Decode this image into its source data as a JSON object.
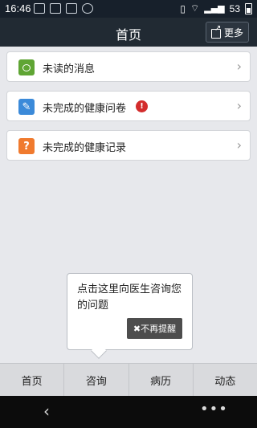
{
  "status_bar": {
    "time": "16:46",
    "battery": "53"
  },
  "header": {
    "title": "首页",
    "more_label": "更多"
  },
  "list": [
    {
      "label": "未读的消息"
    },
    {
      "label": "未完成的健康问卷",
      "badge": "!"
    },
    {
      "label": "未完成的健康记录"
    }
  ],
  "tooltip": {
    "text": "点击这里向医生咨询您的问题",
    "dismiss_label": "✖不再提醒"
  },
  "tabs": [
    {
      "label": "首页"
    },
    {
      "label": "咨询"
    },
    {
      "label": "病历"
    },
    {
      "label": "动态"
    }
  ],
  "icons": {
    "message": "message-icon",
    "questionnaire": "pencil-icon",
    "record": "question-icon"
  },
  "colors": {
    "accent_green": "#5fa534",
    "accent_blue": "#3b8ad9",
    "accent_orange": "#f07a2e",
    "badge_red": "#d32c2c"
  }
}
